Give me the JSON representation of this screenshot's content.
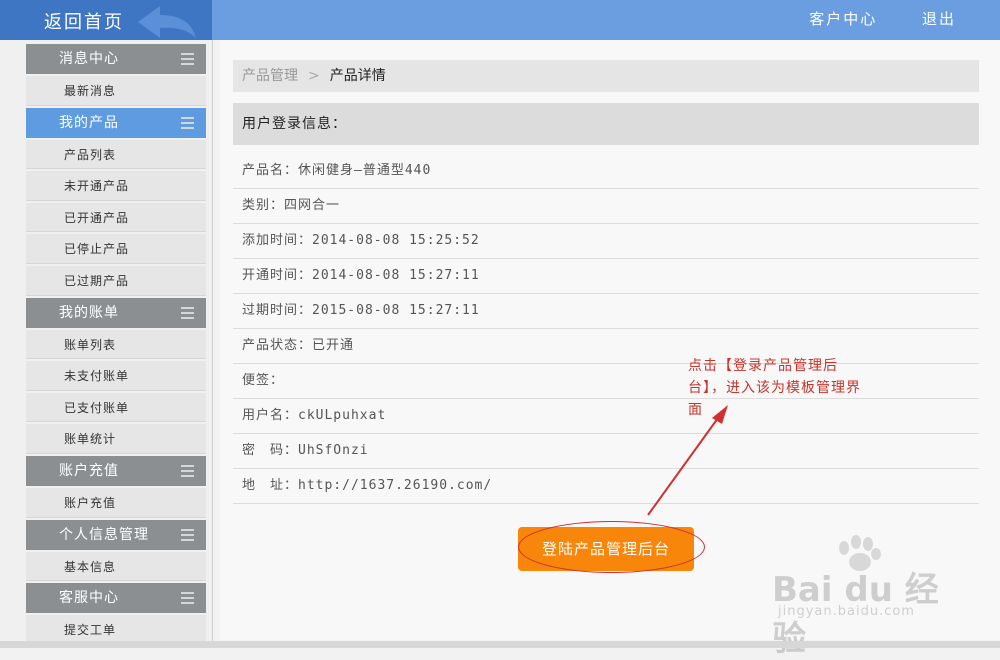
{
  "header": {
    "home_label": "返回首页",
    "customer_center": "客户中心",
    "logout": "退出"
  },
  "sidebar": {
    "sections": [
      {
        "title": "消息中心",
        "items": [
          "最新消息"
        ]
      },
      {
        "title": "我的产品",
        "items": [
          "产品列表",
          "未开通产品",
          "已开通产品",
          "已停止产品",
          "已过期产品"
        ],
        "active": true
      },
      {
        "title": "我的账单",
        "items": [
          "账单列表",
          "未支付账单",
          "已支付账单",
          "账单统计"
        ]
      },
      {
        "title": "账户充值",
        "items": [
          "账户充值"
        ]
      },
      {
        "title": "个人信息管理",
        "items": [
          "基本信息"
        ]
      },
      {
        "title": "客服中心",
        "items": [
          "提交工单"
        ]
      }
    ]
  },
  "breadcrumb": {
    "parent": "产品管理",
    "separator": ">",
    "current": "产品详情"
  },
  "info": {
    "heading": "用户登录信息：",
    "rows": [
      "产品名：休闲健身—普通型440",
      "类别：四网合一",
      "添加时间：2014-08-08 15:25:52",
      "开通时间：2014-08-08 15:27:11",
      "过期时间：2015-08-08 15:27:11",
      "产品状态：已开通",
      "便签：",
      "用户名：ckULpuhxat",
      "密　码：UhSfOnzi",
      "地　址：http://1637.26190.com/"
    ]
  },
  "login_button": "登陆产品管理后台",
  "annotation": {
    "lines": [
      "点击【登录产品管理后",
      "台】，进入该为模板管理界",
      "面"
    ]
  },
  "watermark": {
    "brand": "Bai du 经验",
    "url": "jingyan.baidu.com"
  },
  "colors": {
    "header_bg": "#6a9ee0",
    "home_bg": "#3f76c4",
    "active_section": "#5e9be0",
    "button": "#f7860a",
    "annotation": "#c8342a"
  }
}
